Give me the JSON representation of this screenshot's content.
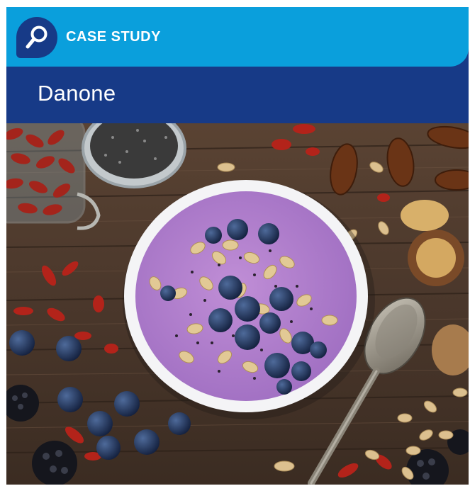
{
  "header": {
    "badge_icon": "search-icon",
    "eyebrow": "CASE STUDY",
    "title": "Danone"
  },
  "colors": {
    "top_bar": "#0a9fdc",
    "title_bar": "#173a87",
    "text": "#ffffff"
  },
  "photo": {
    "subject": "smoothie-bowl-photo"
  }
}
